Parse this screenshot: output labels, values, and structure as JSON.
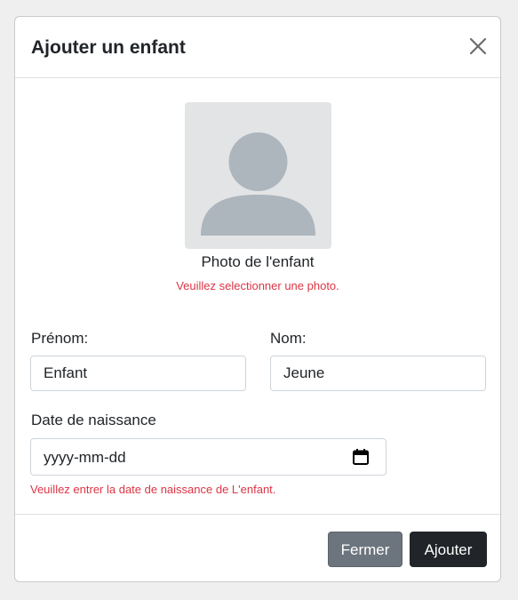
{
  "modal": {
    "title": "Ajouter un enfant",
    "close_icon": "close-icon"
  },
  "photo": {
    "label": "Photo de l'enfant",
    "error": "Veuillez selectionner une photo.",
    "icon": "user-avatar-icon"
  },
  "form": {
    "first_name": {
      "label": "Prénom:",
      "value": "Enfant"
    },
    "last_name": {
      "label": "Nom:",
      "value": "Jeune"
    },
    "birth_date": {
      "label": "Date de naissance",
      "placeholder": "yyyy-mm-dd",
      "error": "Veuillez entrer la date de naissance de L'enfant.",
      "icon": "calendar-icon"
    }
  },
  "footer": {
    "close_label": "Fermer",
    "add_label": "Ajouter"
  },
  "colors": {
    "error": "#dc3545",
    "secondary_button": "#6c757d",
    "primary_button": "#212529",
    "avatar_bg": "#e3e4e6",
    "avatar_fg": "#adb5bd"
  }
}
